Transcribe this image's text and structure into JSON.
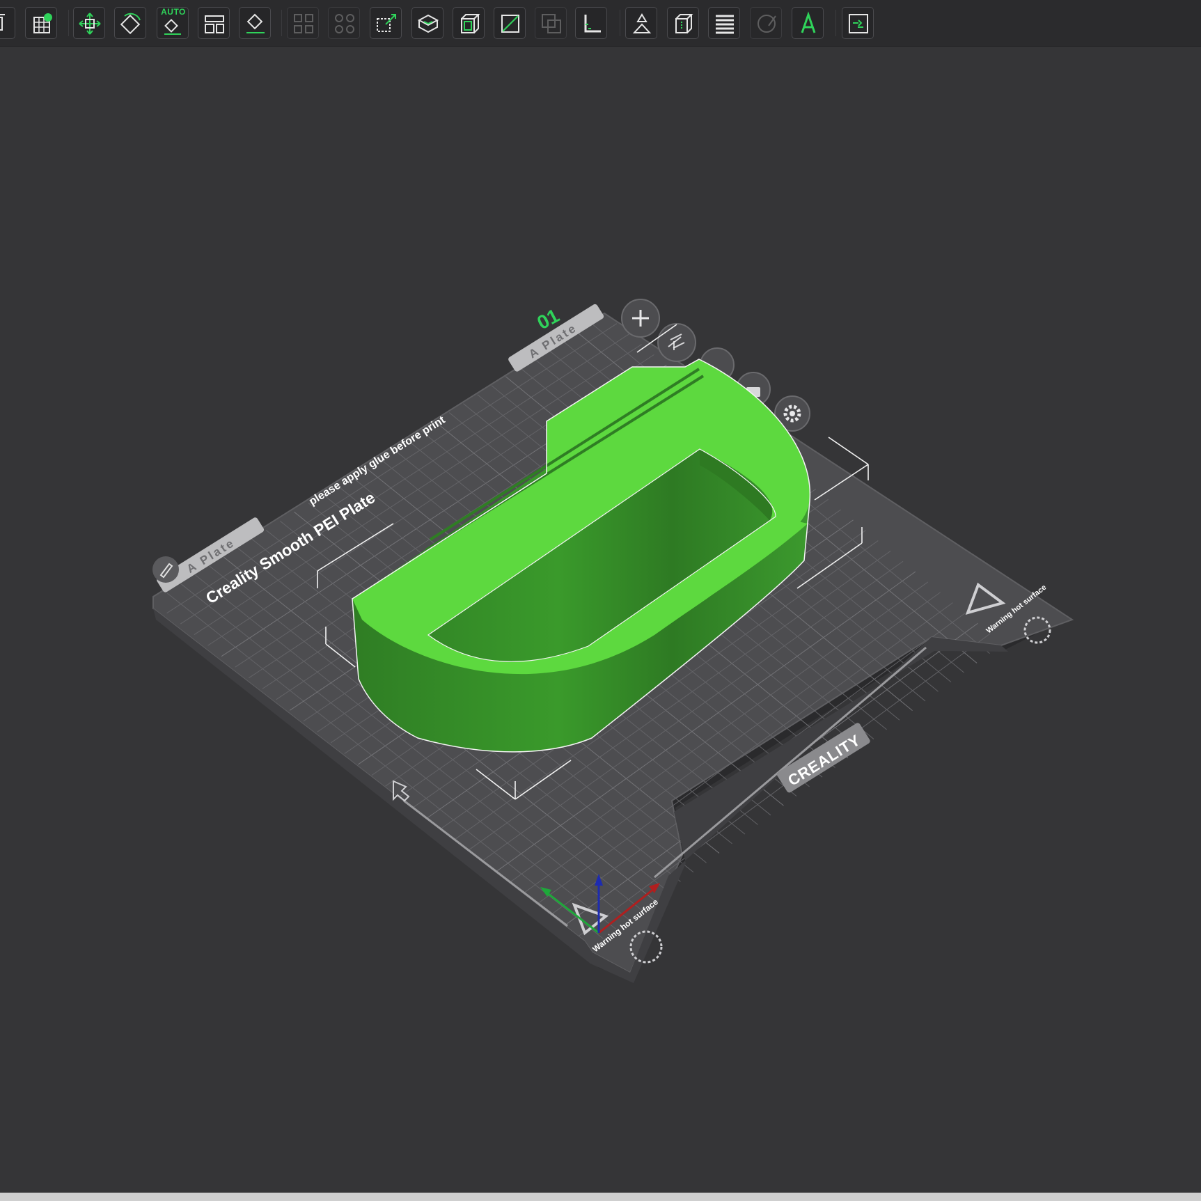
{
  "toolbar": {
    "buttons": [
      {
        "name": "add-object-icon",
        "label": "Add"
      },
      {
        "name": "add-plate-icon",
        "label": "Add plate"
      },
      {
        "name": "move-icon",
        "label": "Move"
      },
      {
        "name": "rotate-icon",
        "label": "Rotate"
      },
      {
        "name": "auto-orient-icon",
        "label": "Auto orient",
        "badge": "AUTO"
      },
      {
        "name": "arrange-icon",
        "label": "Arrange"
      },
      {
        "name": "lay-on-face-icon",
        "label": "Lay on face"
      },
      {
        "name": "split-objects-icon",
        "label": "Split to objects"
      },
      {
        "name": "split-parts-icon",
        "label": "Split to parts"
      },
      {
        "name": "scale-icon",
        "label": "Scale"
      },
      {
        "name": "place-on-bed-icon",
        "label": "Place on bed"
      },
      {
        "name": "box-icon",
        "label": "Box"
      },
      {
        "name": "cut-icon",
        "label": "Cut"
      },
      {
        "name": "boolean-icon",
        "label": "Boolean"
      },
      {
        "name": "measure-icon",
        "label": "Measure"
      },
      {
        "name": "support-paint-icon",
        "label": "Support painting"
      },
      {
        "name": "seam-paint-icon",
        "label": "Seam painting"
      },
      {
        "name": "variable-layer-icon",
        "label": "Variable layer height"
      },
      {
        "name": "color-paint-icon",
        "label": "Color painting"
      },
      {
        "name": "text-icon",
        "label": "Text",
        "glyph": "A"
      },
      {
        "name": "assembly-icon",
        "label": "Assembly"
      }
    ]
  },
  "plate": {
    "number": "01",
    "tab_label_top": "A Plate",
    "tab_label_left": "A Plate",
    "title": "Creality Smooth PEI Plate",
    "notice": "please apply glue before print",
    "brand": "CREALITY",
    "warning_1": "Warning hot surface",
    "warning_2": "Warning hot surface"
  },
  "colors": {
    "background": "#353537",
    "bed": "#4d4d50",
    "grid": "#6a6a6d",
    "model_light": "#5dd93f",
    "model_dark": "#348628",
    "accent": "#2fd35a"
  }
}
